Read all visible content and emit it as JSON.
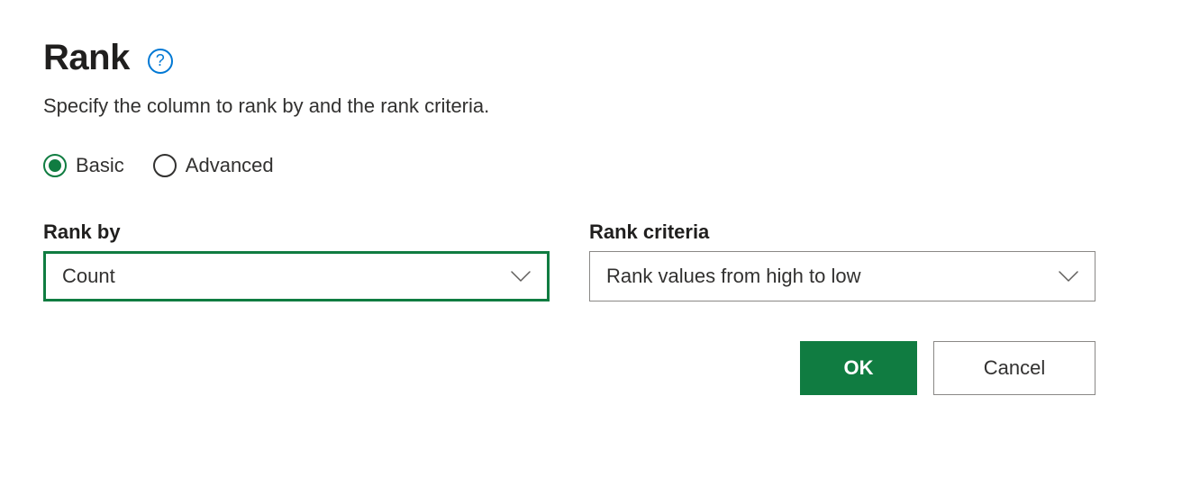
{
  "header": {
    "title": "Rank",
    "help_glyph": "?"
  },
  "subtitle": "Specify the column to rank by and the rank criteria.",
  "mode": {
    "basic_label": "Basic",
    "advanced_label": "Advanced",
    "selected": "basic"
  },
  "fields": {
    "rank_by": {
      "label": "Rank by",
      "value": "Count"
    },
    "rank_criteria": {
      "label": "Rank criteria",
      "value": "Rank values from high to low"
    }
  },
  "buttons": {
    "ok": "OK",
    "cancel": "Cancel"
  },
  "colors": {
    "accent": "#107c41",
    "link": "#0078d4"
  }
}
